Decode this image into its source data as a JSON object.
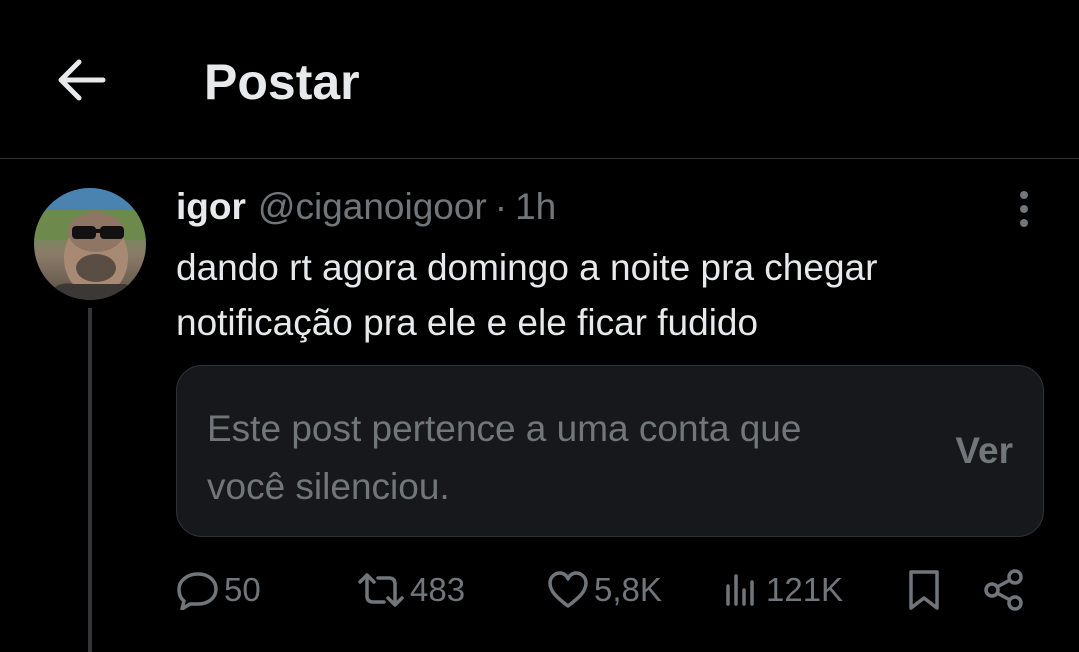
{
  "header": {
    "title": "Postar",
    "back_icon": "arrow-left-icon"
  },
  "post": {
    "author": {
      "display_name": "igor",
      "handle": "@ciganoigoor",
      "separator": "·",
      "time": "1h"
    },
    "text_line1": "dando rt agora domingo a noite pra chegar",
    "text_line2": "notificação pra ele e ele ficar fudido",
    "muted_card": {
      "message_line1": "Este post pertence a uma conta que",
      "message_line2": "você silenciou.",
      "view_label": "Ver"
    },
    "stats": {
      "replies": "50",
      "reposts": "483",
      "likes": "5,8K",
      "views": "121K"
    }
  },
  "colors": {
    "background": "#000000",
    "text_primary": "#e7e9ea",
    "text_secondary": "#71767b",
    "border": "#2f3336",
    "card_background": "#16181c"
  }
}
